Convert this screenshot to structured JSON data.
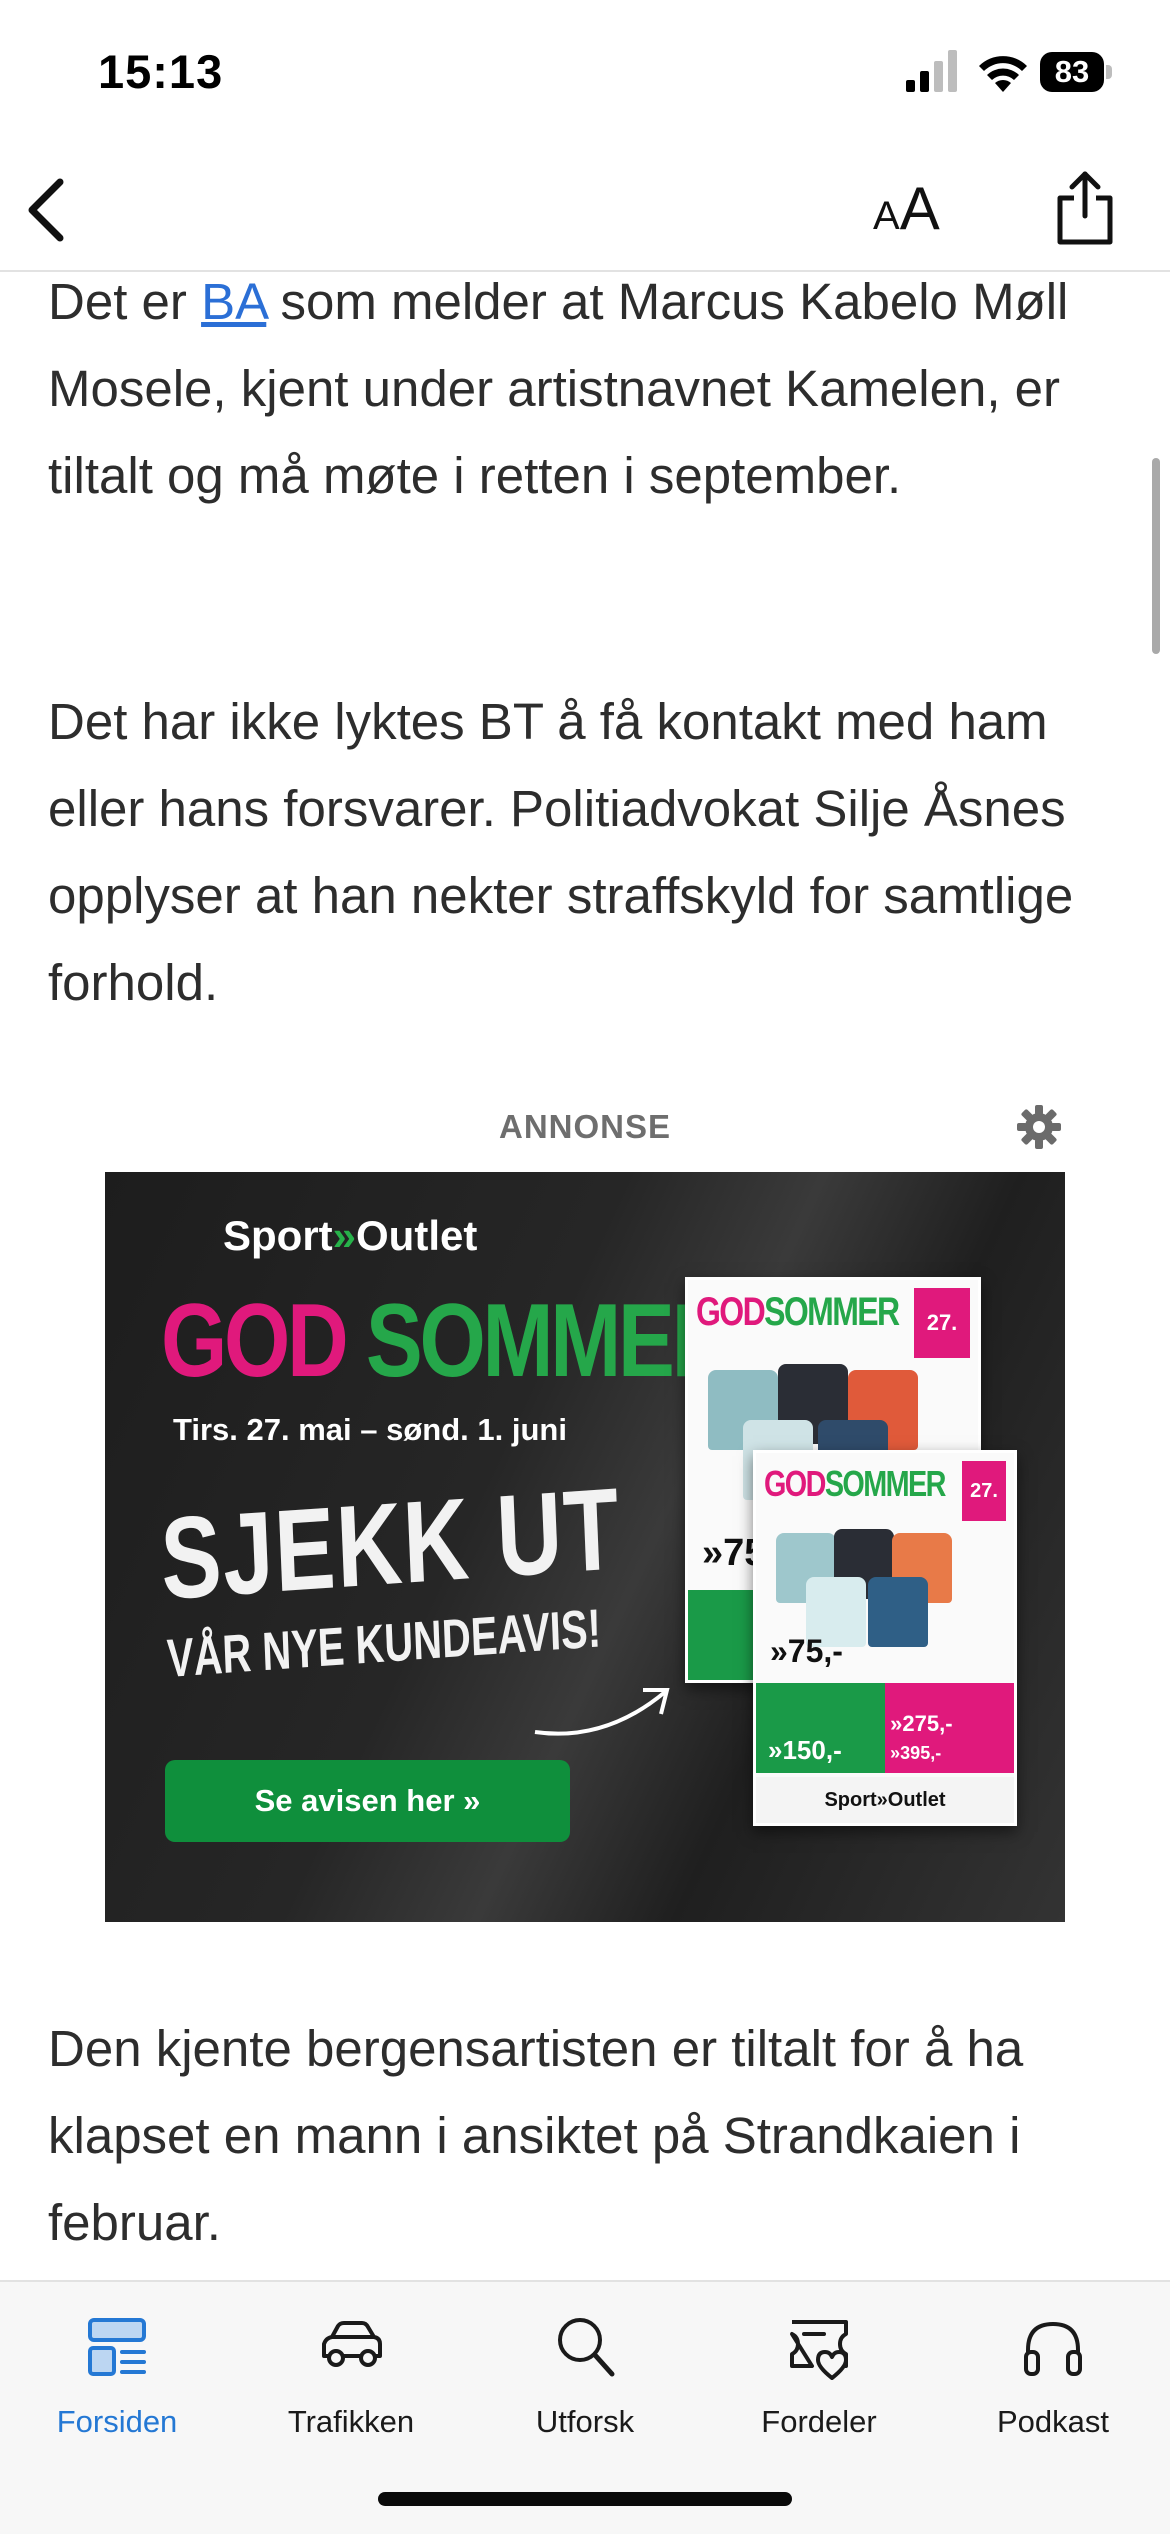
{
  "status": {
    "time": "15:13",
    "battery": "83"
  },
  "toolbar": {
    "text_size_small": "A",
    "text_size_big": "A"
  },
  "article": {
    "p1_before": "Det er ",
    "p1_link": "BA",
    "p1_after": " som melder at Marcus Kabelo Møll Mosele, kjent under artistnavnet Kamelen, er tiltalt og må møte i retten i september.",
    "p2": "Det har ikke lyktes BT å få kontakt med ham eller hans forsvarer. Politiadvokat Silje Åsnes opplyser at han nekter straffskyld for samtlige forhold.",
    "p3": "Den kjente bergensartisten er tiltalt for å ha klapset en mann i ansiktet på Strandkaien i februar."
  },
  "ad": {
    "label": "ANNONSE",
    "brand_left": "Sport",
    "brand_chev": "»",
    "brand_right": "Outlet",
    "headline_1": "GOD",
    "headline_2": "SOMMER",
    "dates": "Tirs. 27. mai – sønd. 1. juni",
    "sjekk": "SJEKK UT",
    "kundeavis": "VÅR NYE KUNDEAVIS!",
    "button": "Se avisen her »",
    "flyer_head_a": "GOD",
    "flyer_head_b": "SOMMER",
    "flyer_badge": "27.",
    "flyer_price_1": "»75,-",
    "flyer_price_2": "»150,-",
    "flyer_price_3": "»275,-",
    "flyer_price_4": "»395,-",
    "flyer_footer": "Sport»Outlet"
  },
  "tabs": [
    {
      "label": "Forsiden",
      "icon": "home-feed-icon",
      "active": true
    },
    {
      "label": "Trafikken",
      "icon": "car-icon",
      "active": false
    },
    {
      "label": "Utforsk",
      "icon": "search-icon",
      "active": false
    },
    {
      "label": "Fordeler",
      "icon": "ticket-heart-icon",
      "active": false
    },
    {
      "label": "Podkast",
      "icon": "headphones-icon",
      "active": false
    }
  ],
  "colors": {
    "accent": "#2478d4",
    "link": "#2b6fd6",
    "ad_pink": "#e0197c",
    "ad_green": "#25a74a"
  }
}
